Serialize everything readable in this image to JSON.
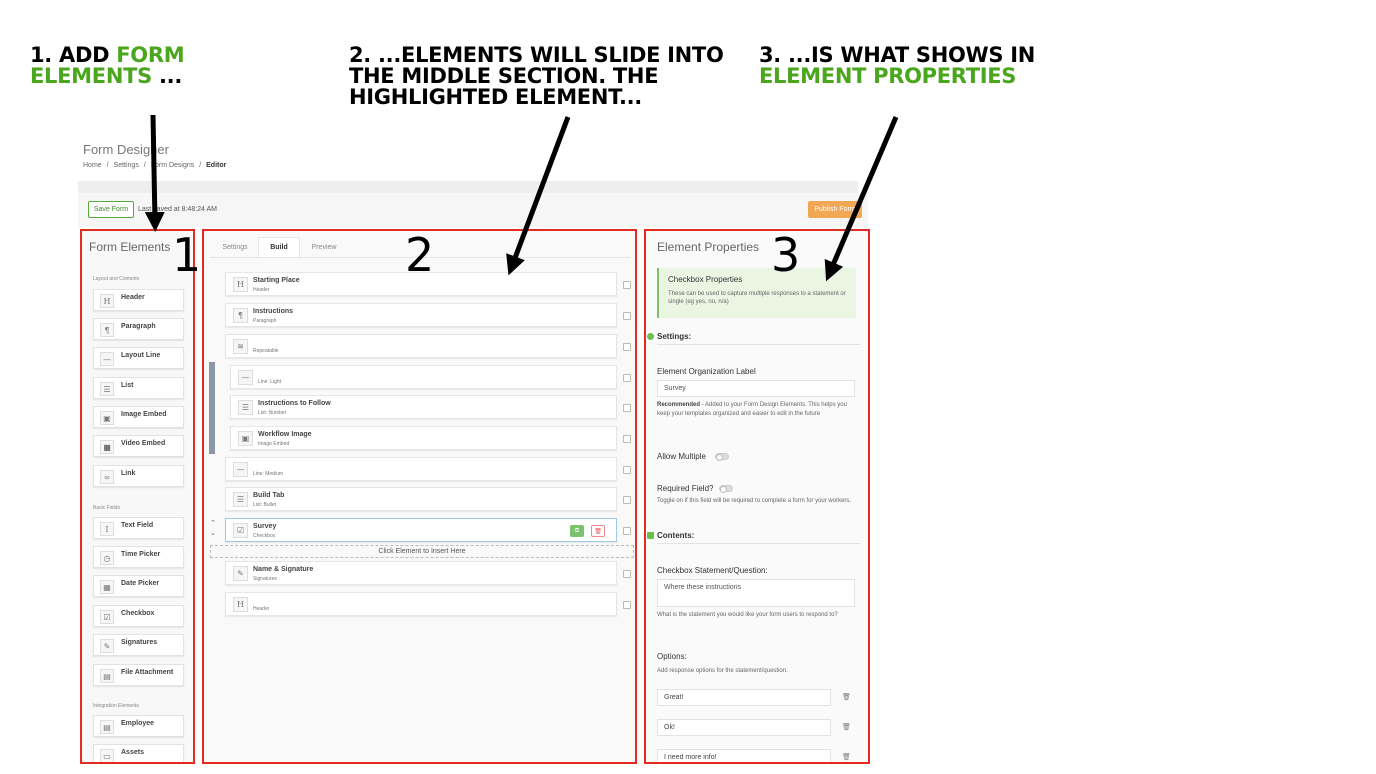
{
  "annotations": {
    "step1": {
      "line1_pre": "1. ADD ",
      "line1_green": "FORM",
      "line2_green": "ELEMENTS",
      "line2_post": " ..."
    },
    "step2": {
      "line1": "2. ...ELEMENTS WILL SLIDE INTO",
      "line2": "THE MIDDLE SECTION. THE",
      "line3": "HIGHLIGHTED ELEMENT..."
    },
    "step3": {
      "line1": "3. ...IS WHAT SHOWS IN",
      "line2_green": "ELEMENT PROPERTIES"
    },
    "num1": "1",
    "num2": "2",
    "num3": "3"
  },
  "colors": {
    "accent_green": "#4aa61c",
    "highlight_red": "#e32b22",
    "publish_orange": "#f2a755"
  },
  "app": {
    "title": "Form Designer",
    "breadcrumb": [
      "Home",
      "/",
      "Settings",
      "/",
      "Form Designs",
      "/",
      "Editor"
    ],
    "save_label": "Save Form",
    "saved_text": "Last saved at 8:48:24 AM",
    "publish_label": "Publish Form"
  },
  "left": {
    "title": "Form Elements",
    "section1": "Layout and Contents",
    "section2": "Basic Fields",
    "section3": "Integration Elements",
    "items": [
      {
        "label": "Header",
        "icon": "H"
      },
      {
        "label": "Paragraph",
        "icon": "¶"
      },
      {
        "label": "Layout Line",
        "icon": "—"
      },
      {
        "label": "List",
        "icon": "☰"
      },
      {
        "label": "Image Embed",
        "icon": "▣"
      },
      {
        "label": "Video Embed",
        "icon": "■"
      },
      {
        "label": "Link",
        "icon": "∞"
      },
      {
        "label": "Text Field",
        "icon": "I"
      },
      {
        "label": "Time Picker",
        "icon": "◷"
      },
      {
        "label": "Date Picker",
        "icon": "▦"
      },
      {
        "label": "Checkbox",
        "icon": "☑"
      },
      {
        "label": "Signatures",
        "icon": "✎"
      },
      {
        "label": "File Attachment",
        "icon": "▤"
      },
      {
        "label": "Employee",
        "icon": "▤"
      },
      {
        "label": "Assets",
        "icon": "▭"
      }
    ]
  },
  "middle": {
    "tabs": [
      "Settings",
      "Build",
      "Preview"
    ],
    "rows": [
      {
        "title": "Starting Place",
        "sub": "Header",
        "icon": "H"
      },
      {
        "title": "Instructions",
        "sub": "Paragraph",
        "icon": "¶"
      },
      {
        "title": "",
        "sub": "Repeatable",
        "icon": "≋"
      },
      {
        "title": "",
        "sub": "Line: Light",
        "icon": "—"
      },
      {
        "title": "Instructions to Follow",
        "sub": "List: Number",
        "icon": "☰"
      },
      {
        "title": "Workflow Image",
        "sub": "Image Embed",
        "icon": "▣"
      },
      {
        "title": "",
        "sub": "Line: Medium",
        "icon": "—"
      },
      {
        "title": "Build Tab",
        "sub": "List: Bullet",
        "icon": "☰"
      },
      {
        "title": "Survey",
        "sub": "Checkbox",
        "icon": "☑"
      },
      {
        "title": "Name & Signature",
        "sub": "Signatures",
        "icon": "✎"
      },
      {
        "title": "",
        "sub": "Header",
        "icon": "H"
      }
    ],
    "insert_text": "Click Element to Insert Here",
    "copy_icon": "⧉",
    "delete_icon": "🗑"
  },
  "right": {
    "title": "Element Properties",
    "info_title": "Checkbox Properties",
    "info_desc": "These can be used to capture multiple responses to a statement or single (eg yes, no, n/a)",
    "settings_head": "Settings:",
    "org_label": "Element Organization Label",
    "org_value": "Survey",
    "org_help_bold": "Recommended",
    "org_help": " - Added to your Form Design Elements. This helps you keep your templates organized and easier to edit in the future",
    "allow_multiple": "Allow Multiple",
    "required_label": "Required Field?",
    "required_help": "Toggle on if this field will be required to complete a form for your workers.",
    "contents_head": "Contents:",
    "statement_label": "Checkbox Statement/Question:",
    "statement_value": "Where these instructions",
    "statement_help": "What is the statement you would like your form users to respond to?",
    "options_label": "Options:",
    "options_help": "Add response options for the statement/question.",
    "options": [
      "Great!",
      "Ok!",
      "I need more info!"
    ],
    "trash_icon": "🗑"
  }
}
